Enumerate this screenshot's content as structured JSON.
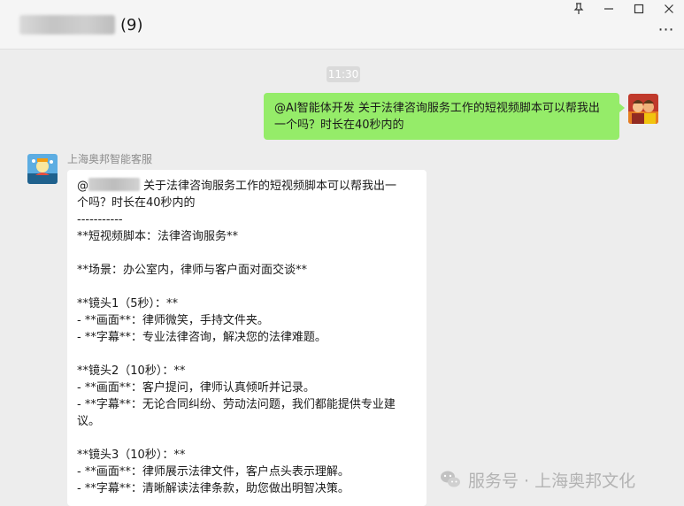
{
  "window": {
    "title_suffix": "(9)",
    "controls": {
      "pin": "⚲",
      "minimize": "—",
      "maximize": "☐",
      "close": "✕"
    },
    "more": "⋯"
  },
  "chat": {
    "timestamp": "11:30",
    "sent_message": {
      "text": "@AI智能体开发 关于法律咨询服务工作的短视频脚本可以帮我出一个吗？时长在40秒内的",
      "bubble_color": "#95ec69"
    },
    "reply": {
      "sender": "上海奥邦智能客服",
      "mention_prefix": "@",
      "first_line_rest": "关于法律咨询服务工作的短视频脚本可以帮我出一",
      "lines": [
        "个吗？时长在40秒内的",
        "-----------",
        "**短视频脚本：法律咨询服务**",
        "",
        "**场景：办公室内，律师与客户面对面交谈**",
        "",
        "**镜头1（5秒）：**",
        "- **画面**：律师微笑，手持文件夹。",
        "- **字幕**：专业法律咨询，解决您的法律难题。",
        "",
        "**镜头2（10秒）：**",
        "- **画面**：客户提问，律师认真倾听并记录。",
        "- **字幕**：无论合同纠纷、劳动法问题，我们都能提供专业建",
        "议。",
        "",
        "**镜头3（10秒）：**",
        "- **画面**：律师展示法律文件，客户点头表示理解。",
        "- **字幕**：清晰解读法律条款，助您做出明智决策。"
      ]
    }
  },
  "watermark": {
    "text": "服务号 · 上海奥邦文化",
    "icon": "wechat-icon"
  }
}
